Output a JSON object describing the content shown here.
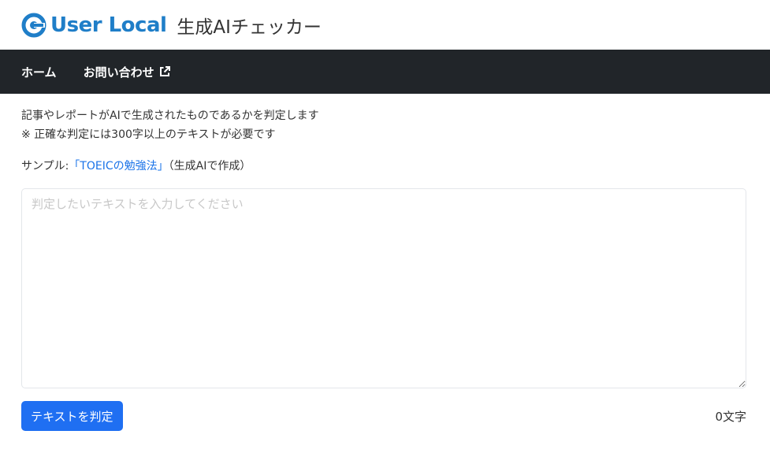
{
  "header": {
    "logo_text": "User Local",
    "app_title": "生成AIチェッカー"
  },
  "nav": {
    "home": "ホーム",
    "contact": "お問い合わせ"
  },
  "main": {
    "description_line1": "記事やレポートがAIで生成されたものであるかを判定します",
    "description_line2": "※ 正確な判定には300字以上のテキストが必要です",
    "sample_label": "サンプル:",
    "sample_link": "「TOEICの勉強法」",
    "sample_note": "（生成AIで作成）",
    "textarea_placeholder": "判定したいテキストを入力してください",
    "textarea_value": "",
    "submit_label": "テキストを判定",
    "char_count": "0文字"
  },
  "icons": {
    "logo": "user-local-logo-icon",
    "external": "external-link-icon"
  },
  "colors": {
    "brand": "#1f7ec8",
    "navbar": "#212529",
    "button": "#1f6ff2",
    "link": "#1a73e8"
  }
}
